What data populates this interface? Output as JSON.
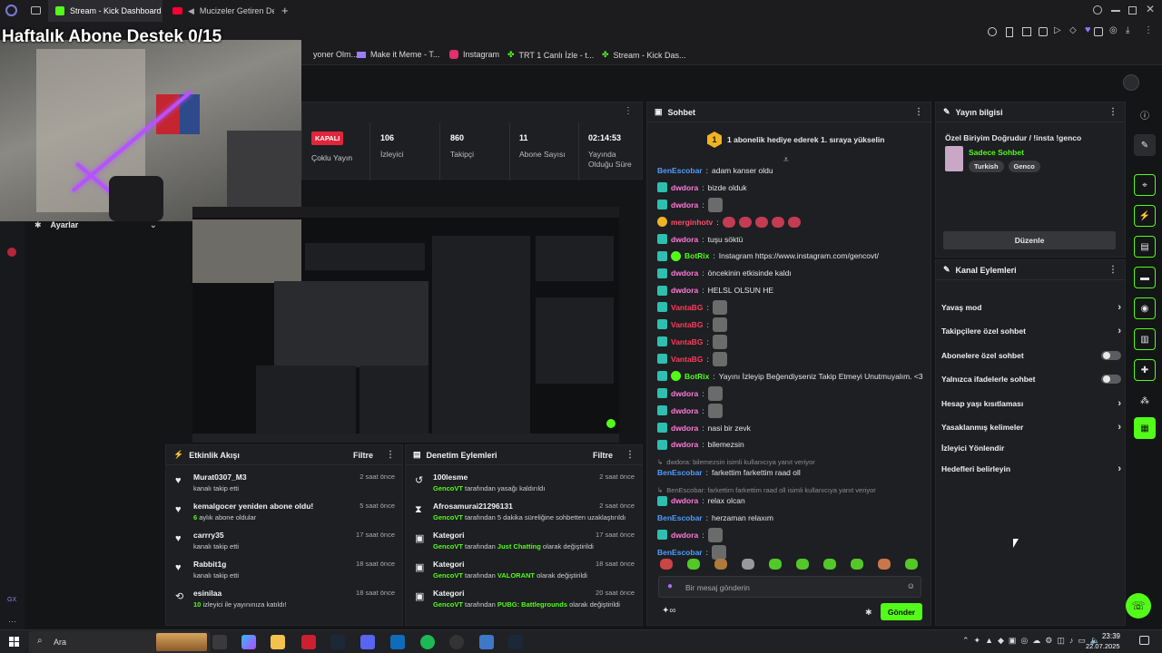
{
  "browser": {
    "tabs": [
      {
        "label": "Stream - Kick Dashboard",
        "active": true
      },
      {
        "label": "Mucizeler Getiren De",
        "active": false
      }
    ],
    "new_tab": "+",
    "bookmarks": [
      "yoner Olm...",
      "Make it Meme - T...",
      "Instagram",
      "TRT 1 Canlı İzle - t...",
      "Stream - Kick Das..."
    ]
  },
  "overlay": {
    "title": "Haftalık Abone Destek 0/15"
  },
  "settings": {
    "label": "Ayarlar"
  },
  "stats": {
    "status": "KAPALI",
    "status_label": "Çoklu Yayın",
    "items": [
      {
        "value": "106",
        "label": "İzleyici"
      },
      {
        "value": "860",
        "label": "Takipçi"
      },
      {
        "value": "11",
        "label": "Abone Sayısı"
      },
      {
        "value": "02:14:53",
        "label": "Yayında Olduğu Süre"
      }
    ]
  },
  "activity": {
    "title": "Etkinlik Akışı",
    "filter": "Filtre",
    "items": [
      {
        "title": "Murat0307_M3",
        "sub": "kanalı takip etti",
        "time": "2 saat önce",
        "icon": "heart-icon"
      },
      {
        "title": "kemalgocer yeniden abone oldu!",
        "sub_num": "6",
        "sub": "aylık abone oldular",
        "time": "5 saat önce",
        "icon": "star-icon"
      },
      {
        "title": "carrry35",
        "sub": "kanalı takip etti",
        "time": "17 saat önce",
        "icon": "heart-icon"
      },
      {
        "title": "Rabbit1g",
        "sub": "kanalı takip etti",
        "time": "18 saat önce",
        "icon": "heart-icon"
      },
      {
        "title": "esinilaa",
        "sub_num": "10",
        "sub": "izleyici ile yayınınıza katıldı!",
        "time": "18 saat önce",
        "icon": "raid-icon"
      }
    ]
  },
  "moderation": {
    "title": "Denetim Eylemleri",
    "filter": "Filtre",
    "items": [
      {
        "title": "100lesme",
        "by": "GencoVT",
        "mid": "tarafından yasağı kaldırıldı",
        "hl": "",
        "end": "",
        "time": "2 saat önce",
        "icon": "undo-icon"
      },
      {
        "title": "Afrosamurai21296131",
        "by": "GencoVT",
        "mid": "tarafından 5 dakika süreliğine sohbetten uzaklaştırıldı",
        "hl": "",
        "end": "",
        "time": "2 saat önce",
        "icon": "hourglass-icon"
      },
      {
        "title": "Kategori",
        "by": "GencoVT",
        "mid": "tarafından",
        "hl": "Just Chatting",
        "end": "olarak değiştirildi",
        "time": "17 saat önce",
        "icon": "category-icon"
      },
      {
        "title": "Kategori",
        "by": "GencoVT",
        "mid": "tarafından",
        "hl": "VALORANT",
        "end": "olarak değiştirildi",
        "time": "18 saat önce",
        "icon": "category-icon"
      },
      {
        "title": "Kategori",
        "by": "GencoVT",
        "mid": "tarafından",
        "hl": "PUBG: Battlegrounds",
        "end": "olarak değiştirildi",
        "time": "20 saat önce",
        "icon": "category-icon"
      }
    ]
  },
  "chat": {
    "title": "Sohbet",
    "pinned": "1 abonelik hediye ederek 1. sıraya yükselin",
    "pinned_num": "1",
    "messages": [
      {
        "user": "BenEscobar",
        "text": "adam kanser oldu",
        "color": "#4f9dff"
      },
      {
        "user": "dwdora",
        "text": "bizde olduk",
        "color": "#ff7ad9"
      },
      {
        "user": "dwdora",
        "text": "",
        "color": "#ff7ad9",
        "emote": true
      },
      {
        "user": "merginhotv",
        "text": "",
        "color": "#ff4d6d",
        "emote": true
      },
      {
        "user": "dwdora",
        "text": "tuşu söktü",
        "color": "#ff7ad9"
      },
      {
        "user": "BotRix",
        "text": "Instagram https://www.instagram.com/gencovt/",
        "color": "#53fc18"
      },
      {
        "user": "dwdora",
        "text": "öncekinin etkisinde kaldı",
        "color": "#ff7ad9"
      },
      {
        "user": "dwdora",
        "text": "HELSL OLSUN HE",
        "color": "#ff7ad9"
      },
      {
        "user": "VantaBG",
        "text": "",
        "color": "#ff3b5c",
        "emote": true
      },
      {
        "user": "VantaBG",
        "text": "",
        "color": "#ff3b5c",
        "emote": true
      },
      {
        "user": "VantaBG",
        "text": "",
        "color": "#ff3b5c",
        "emote": true
      },
      {
        "user": "VantaBG",
        "text": "",
        "color": "#ff3b5c",
        "emote": true
      },
      {
        "user": "BotRix",
        "text": "Yayını İzleyip Beğendiyseniz Takip Etmeyi Unutmuyalım. <3",
        "color": "#53fc18"
      },
      {
        "user": "dwdora",
        "text": "",
        "color": "#ff7ad9",
        "emote": true
      },
      {
        "user": "dwdora",
        "text": "",
        "color": "#ff7ad9",
        "emote": true
      },
      {
        "user": "dwdora",
        "text": "nasi bir zevk",
        "color": "#ff7ad9"
      },
      {
        "user": "dwdora",
        "text": "bilemezsin",
        "color": "#ff7ad9"
      },
      {
        "reply": "dwdora: bilemezsin isimli kullanıcıya yanıt veriyor",
        "user": "BenEscobar",
        "text": "farkettim farkettim raad oll",
        "color": "#4f9dff"
      },
      {
        "reply": "BenEscobar: farkettim farkettim raad oll isimli kullanıcıya yanıt veriyor",
        "user": "dwdora",
        "text": "relax olcan",
        "color": "#ff7ad9"
      },
      {
        "user": "BenEscobar",
        "text": "herzaman relaxım",
        "color": "#4f9dff"
      },
      {
        "user": "dwdora",
        "text": "",
        "color": "#ff7ad9",
        "emote": true
      },
      {
        "user": "BenEscobar",
        "text": "",
        "color": "#4f9dff",
        "emote": true
      }
    ],
    "input_placeholder": "Bir mesaj gönderin",
    "send": "Gönder"
  },
  "stream_info": {
    "title": "Yayın bilgisi",
    "stream_title": "Özel Biriyim Doğrudur / !insta !genco",
    "category": "Sadece Sohbet",
    "tags": [
      "Turkish",
      "Genco"
    ],
    "edit": "Düzenle"
  },
  "channel_actions": {
    "title": "Kanal Eylemleri",
    "items": [
      {
        "label": "Yavaş mod",
        "control": "chevron"
      },
      {
        "label": "Takipçilere özel sohbet",
        "control": "chevron"
      },
      {
        "label": "Abonelere özel sohbet",
        "control": "toggle"
      },
      {
        "label": "Yalnızca ifadelerle sohbet",
        "control": "toggle"
      },
      {
        "label": "Hesap yaşı kısıtlaması",
        "control": "chevron"
      },
      {
        "label": "Yasaklanmış kelimeler",
        "control": "chevron"
      },
      {
        "label": "İzleyici Yönlendir",
        "control": "none"
      },
      {
        "label": "Hedefleri belirleyin",
        "control": "chevron"
      }
    ]
  },
  "taskbar": {
    "search": "Ara",
    "time": "23:39",
    "date": "22.07.2025"
  },
  "colors": {
    "kick_green": "#53fc18",
    "panel": "#1d1f22",
    "bg": "#141517"
  }
}
